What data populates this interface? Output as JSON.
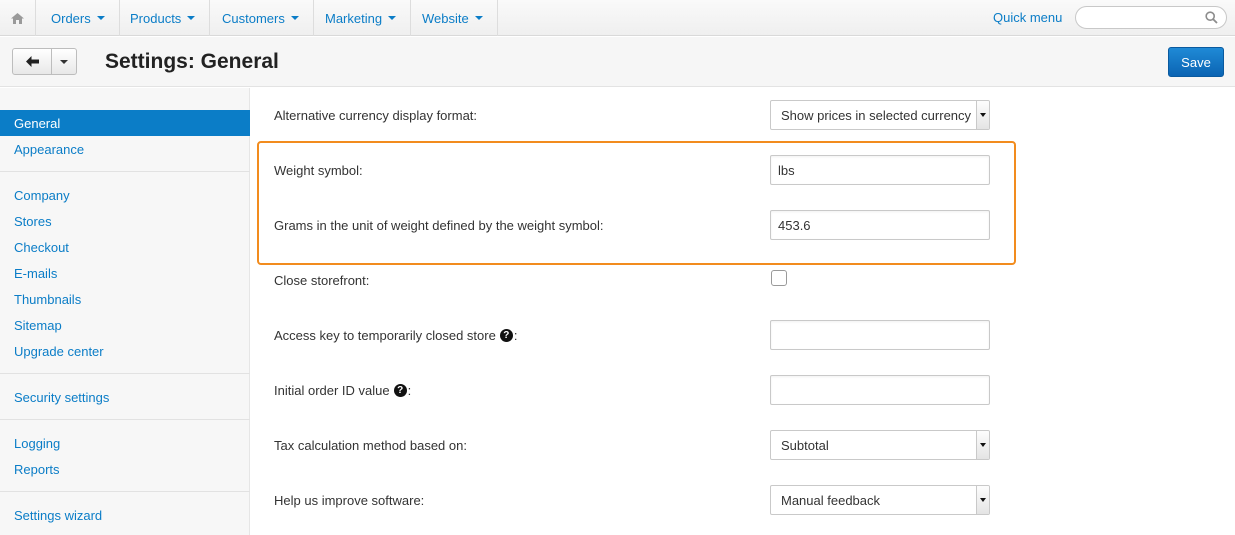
{
  "nav": {
    "home_icon": "home-icon",
    "items": [
      {
        "label": "Orders"
      },
      {
        "label": "Products"
      },
      {
        "label": "Customers"
      },
      {
        "label": "Marketing"
      },
      {
        "label": "Website"
      }
    ],
    "quick_menu": "Quick menu",
    "search_placeholder": ""
  },
  "header": {
    "title": "Settings: General",
    "save_label": "Save"
  },
  "sidebar": {
    "items": [
      {
        "label": "General",
        "active": true
      },
      {
        "label": "Appearance"
      },
      {
        "label": "Company"
      },
      {
        "label": "Stores"
      },
      {
        "label": "Checkout"
      },
      {
        "label": "E-mails"
      },
      {
        "label": "Thumbnails"
      },
      {
        "label": "Sitemap"
      },
      {
        "label": "Upgrade center"
      },
      {
        "label": "Security settings"
      },
      {
        "label": "Logging"
      },
      {
        "label": "Reports"
      },
      {
        "label": "Settings wizard"
      }
    ]
  },
  "settings": {
    "alt_currency": {
      "label": "Alternative currency display format:",
      "value": "Show prices in selected currency"
    },
    "weight_symbol": {
      "label": "Weight symbol:",
      "value": "lbs"
    },
    "grams_unit": {
      "label": "Grams in the unit of weight defined by the weight symbol:",
      "value": "453.6"
    },
    "close_storefront": {
      "label": "Close storefront:",
      "checked": false
    },
    "access_key": {
      "label": "Access key to temporarily closed store",
      "suffix": ":",
      "value": ""
    },
    "initial_order_id": {
      "label": "Initial order ID value",
      "suffix": ":",
      "value": ""
    },
    "tax_method": {
      "label": "Tax calculation method based on:",
      "value": "Subtotal"
    },
    "help_improve": {
      "label": "Help us improve software:",
      "value": "Manual feedback"
    }
  },
  "colors": {
    "accent": "#0b7dc7",
    "highlight": "#f28c1e",
    "save": "#1572c4"
  }
}
